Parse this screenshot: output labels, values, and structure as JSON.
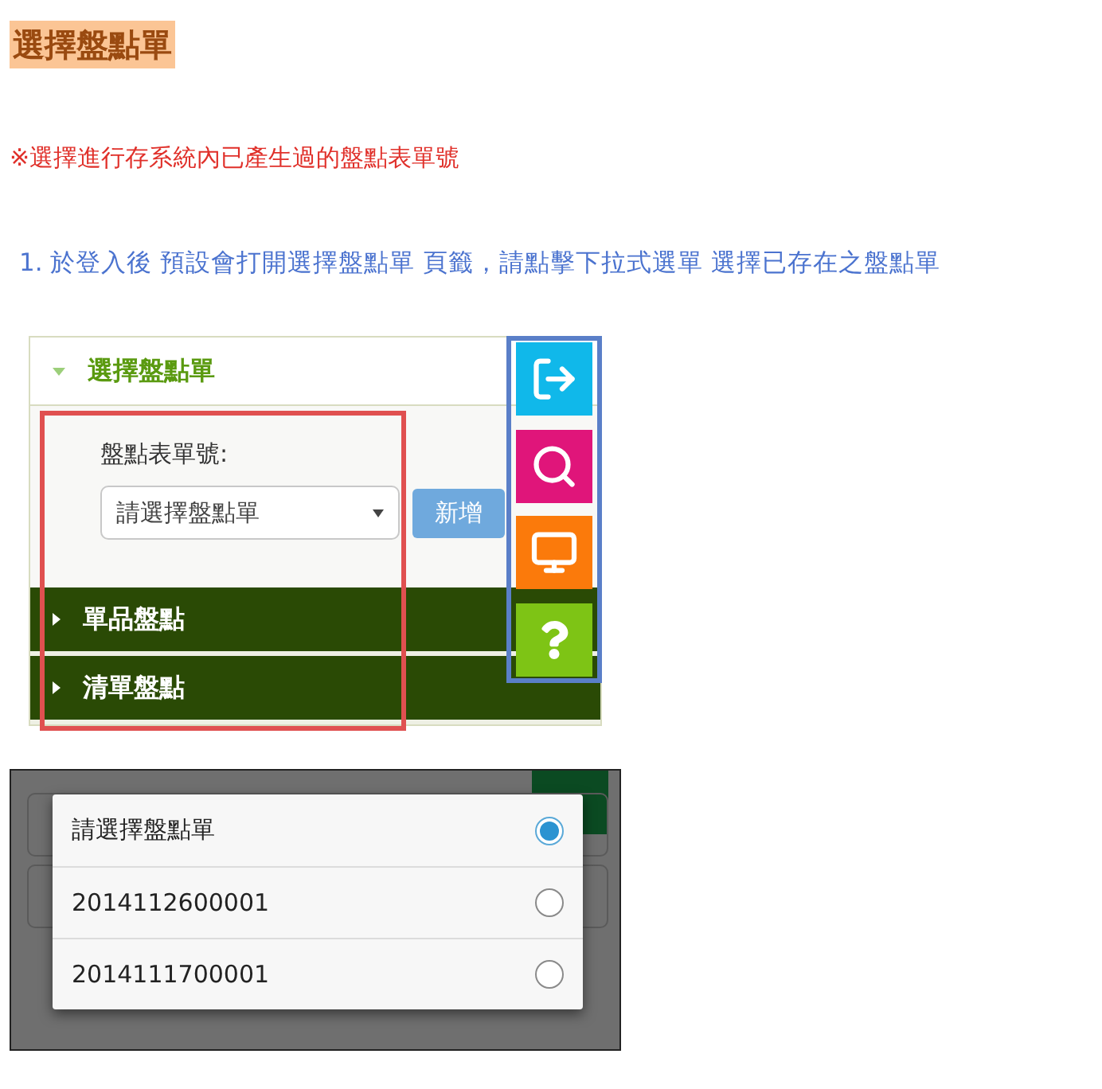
{
  "heading": "選擇盤點單",
  "note": "※選擇進行存系統內已產生過的盤點表單號",
  "instruction": "1. 於登入後 預設會打開選擇盤點單 頁籤，請點擊下拉式選單 選擇已存在之盤點單",
  "screenshot_1": {
    "sections": [
      {
        "title": "選擇盤點單",
        "expanded": true
      },
      {
        "title": "單品盤點",
        "expanded": false
      },
      {
        "title": "清單盤點",
        "expanded": false
      }
    ],
    "field_label": "盤點表單號:",
    "select": {
      "value": "請選擇盤點單"
    },
    "add_button": "新增"
  },
  "screenshot_2": {
    "options": [
      {
        "label": "請選擇盤點單",
        "selected": true
      },
      {
        "label": "2014112600001",
        "selected": false
      },
      {
        "label": "2014111700001",
        "selected": false
      }
    ]
  }
}
